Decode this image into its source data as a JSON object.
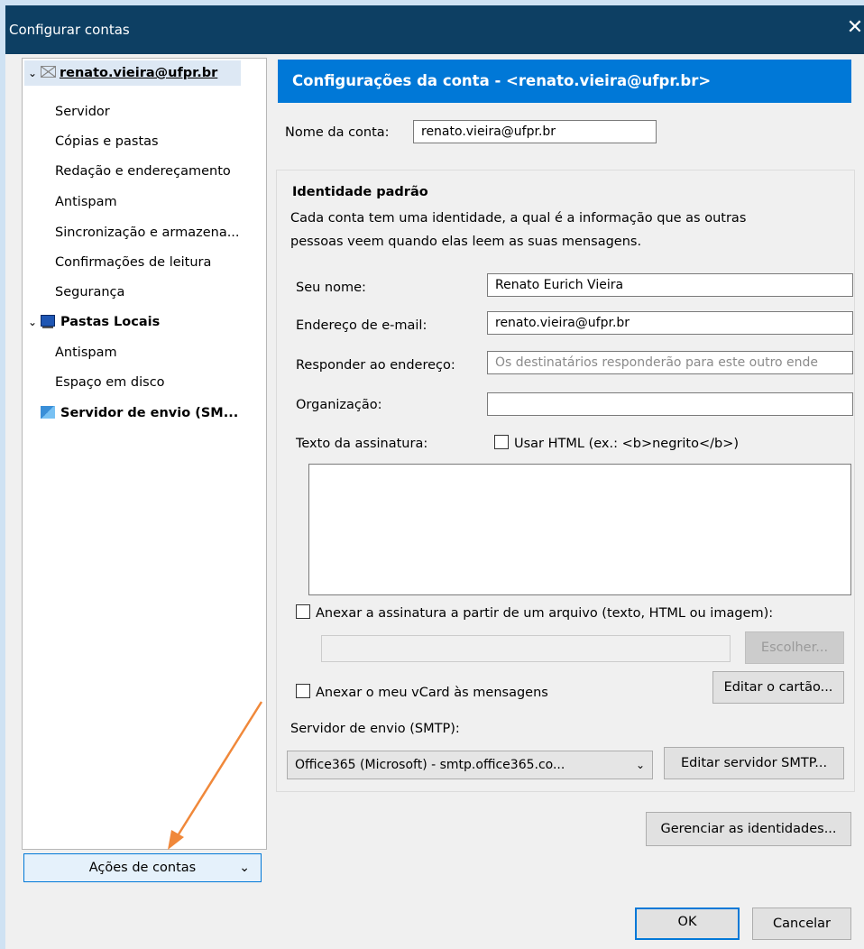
{
  "window": {
    "title": "Configurar contas",
    "close_glyph": "✕"
  },
  "tree": {
    "account": "renato.vieira@ufpr.br",
    "account_items": [
      "Servidor",
      "Cópias e pastas",
      "Redação e endereçamento",
      "Antispam",
      "Sincronização e armazena...",
      "Confirmações de leitura",
      "Segurança"
    ],
    "local_folders": "Pastas Locais",
    "local_items": [
      "Antispam",
      "Espaço em disco"
    ],
    "outgoing": "Servidor de envio (SM..."
  },
  "actions_button": "Ações de contas",
  "panel": {
    "header": "Configurações da conta - <renato.vieira@ufpr.br>",
    "account_name_label": "Nome da conta:",
    "account_name_value": "renato.vieira@ufpr.br",
    "identity_title": "Identidade padrão",
    "identity_desc_1": "Cada conta tem uma identidade, a qual é a informação que as outras",
    "identity_desc_2": "pessoas veem quando elas leem as suas mensagens.",
    "name_label": "Seu nome:",
    "name_value": "Renato Eurich Vieira",
    "email_label": "Endereço de e-mail:",
    "email_value": "renato.vieira@ufpr.br",
    "reply_label": "Responder ao endereço:",
    "reply_placeholder": "Os destinatários responderão para este outro ende",
    "org_label": "Organização:",
    "org_value": "",
    "sig_label": "Texto da assinatura:",
    "use_html": "Usar HTML (ex.: <b>negrito</b>)",
    "attach_sig": "Anexar a assinatura a partir de um arquivo (texto, HTML ou imagem):",
    "choose_button": "Escolher...",
    "attach_vcard": "Anexar o meu vCard às mensagens",
    "edit_card_button": "Editar o cartão...",
    "smtp_label": "Servidor de envio (SMTP):",
    "smtp_value": "Office365 (Microsoft) - smtp.office365.co...",
    "edit_smtp_button": "Editar servidor SMTP...",
    "manage_identities_button": "Gerenciar as identidades...",
    "ok_button": "OK",
    "cancel_button": "Cancelar"
  },
  "colors": {
    "titlebar": "#0d3f63",
    "header": "#0078d7",
    "annotation_arrow": "#f0883a"
  }
}
